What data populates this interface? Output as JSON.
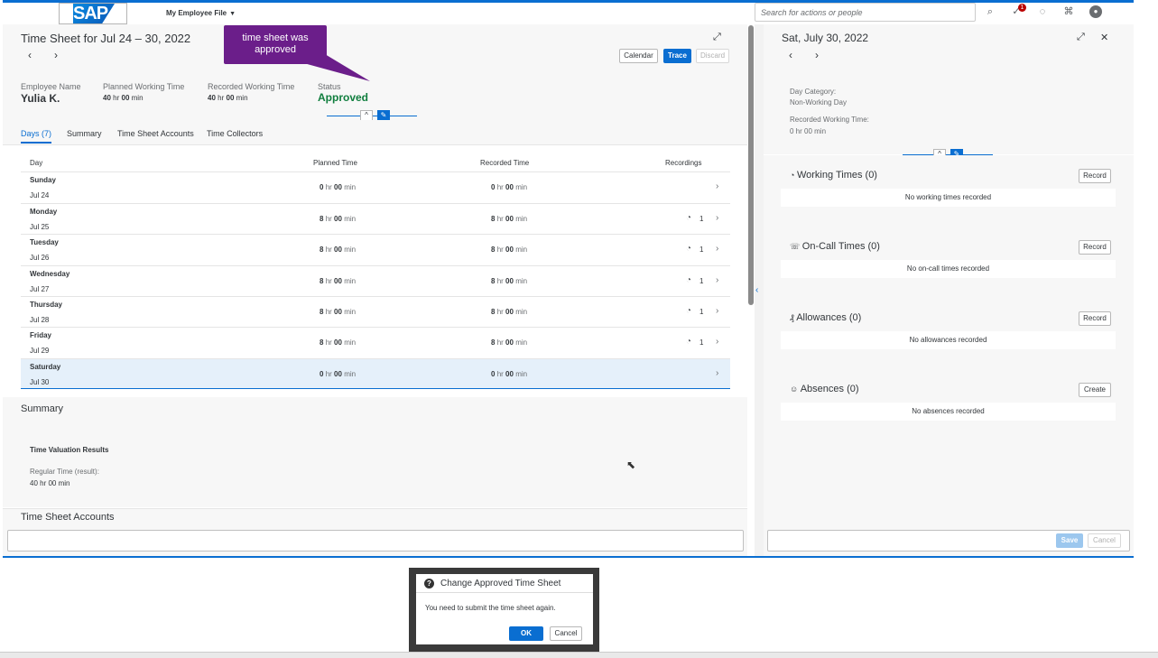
{
  "shell": {
    "logo_text": "SAP",
    "app_title": "My Employee File",
    "search_placeholder": "Search for actions or people",
    "notification_count": "1"
  },
  "timesheet": {
    "title": "Time Sheet for Jul 24 – 30, 2022",
    "actions": {
      "calendar": "Calendar",
      "trace": "Trace",
      "discard": "Discard"
    },
    "tooltip": "time sheet was approved",
    "employee_name_label": "Employee Name",
    "employee_name": "Yulia K.",
    "planned_label": "Planned Working Time",
    "planned_hr": "40",
    "planned_min": "00",
    "recorded_label": "Recorded Working Time",
    "recorded_hr": "40",
    "recorded_min": "00",
    "status_label": "Status",
    "status_value": "Approved",
    "tabs": [
      "Days (7)",
      "Summary",
      "Time Sheet Accounts",
      "Time Collectors"
    ],
    "columns": [
      "Day",
      "Planned Time",
      "Recorded Time",
      "Recordings"
    ],
    "rows": [
      {
        "day": "Sunday",
        "date": "Jul 24",
        "planned_hr": "0",
        "recorded_hr": "0",
        "recordings": ""
      },
      {
        "day": "Monday",
        "date": "Jul 25",
        "planned_hr": "8",
        "recorded_hr": "8",
        "recordings": "1"
      },
      {
        "day": "Tuesday",
        "date": "Jul 26",
        "planned_hr": "8",
        "recorded_hr": "8",
        "recordings": "1"
      },
      {
        "day": "Wednesday",
        "date": "Jul 27",
        "planned_hr": "8",
        "recorded_hr": "8",
        "recordings": "1"
      },
      {
        "day": "Thursday",
        "date": "Jul 28",
        "planned_hr": "8",
        "recorded_hr": "8",
        "recordings": "1"
      },
      {
        "day": "Friday",
        "date": "Jul 29",
        "planned_hr": "8",
        "recorded_hr": "8",
        "recordings": "1"
      },
      {
        "day": "Saturday",
        "date": "Jul 30",
        "planned_hr": "0",
        "recorded_hr": "0",
        "recordings": ""
      }
    ],
    "units": {
      "hr": "hr",
      "min": "min",
      "zero_min": "00"
    },
    "summary_title": "Summary",
    "valuation_title": "Time Valuation Results",
    "regular_label": "Regular Time (result):",
    "regular_value": "40 hr 00 min",
    "accounts_title": "Time Sheet Accounts"
  },
  "detail": {
    "title": "Sat, July 30, 2022",
    "day_category_label": "Day Category:",
    "day_category_value": "Non-Working Day",
    "recorded_label": "Recorded Working Time:",
    "recorded_value": "0 hr 00 min",
    "sections": [
      {
        "title": "Working Times (0)",
        "button": "Record",
        "empty": "No working times recorded"
      },
      {
        "title": "On-Call Times (0)",
        "button": "Record",
        "empty": "No on-call times recorded"
      },
      {
        "title": "Allowances (0)",
        "button": "Record",
        "empty": "No allowances recorded"
      },
      {
        "title": "Absences (0)",
        "button": "Create",
        "empty": "No absences recorded"
      }
    ],
    "save": "Save",
    "cancel": "Cancel"
  },
  "dialog": {
    "title": "Change Approved Time Sheet",
    "message": "You need to submit the time sheet again.",
    "ok": "OK",
    "cancel": "Cancel"
  },
  "colors": {
    "accent": "#0a6ed1",
    "approved": "#107e3e",
    "tooltip": "#6b1e8a"
  }
}
